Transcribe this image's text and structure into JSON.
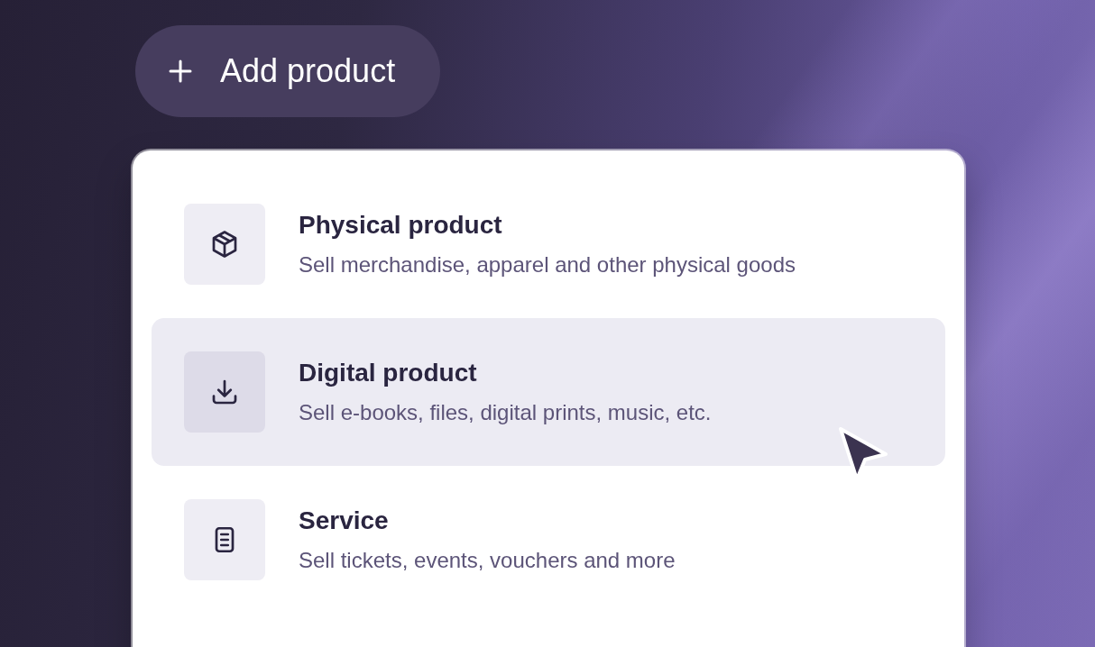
{
  "add_button": {
    "label": "Add product"
  },
  "options": [
    {
      "kind": "physical",
      "title": "Physical product",
      "description": "Sell merchandise, apparel and other physical goods",
      "selected": false
    },
    {
      "kind": "digital",
      "title": "Digital product",
      "description": "Sell e-books, files, digital prints, music, etc.",
      "selected": true
    },
    {
      "kind": "service",
      "title": "Service",
      "description": "Sell tickets, events, vouchers and more",
      "selected": false
    }
  ]
}
